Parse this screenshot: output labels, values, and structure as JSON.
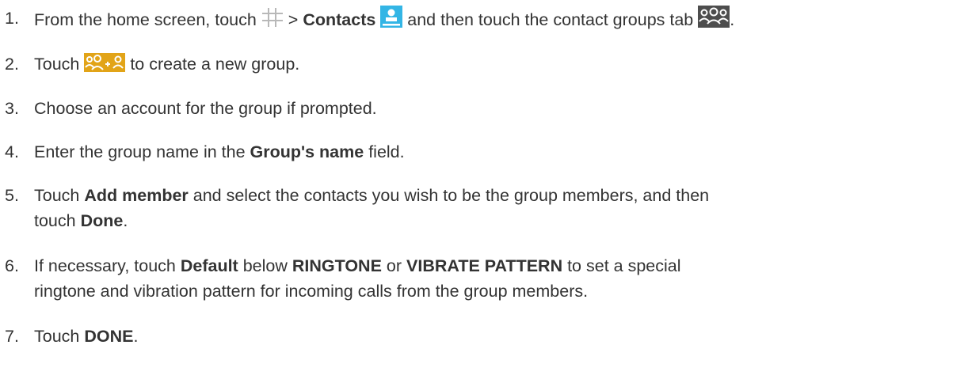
{
  "steps": [
    {
      "number": "1.",
      "parts": {
        "a": "From the home screen, touch",
        "b": " > ",
        "c": "Contacts",
        "d": " and then touch the contact groups tab",
        "e": "."
      },
      "icons": [
        "apps-grid-icon",
        "contacts-app-icon",
        "contact-groups-tab-icon"
      ],
      "colors": {
        "contacts_icon": "#33b5e5",
        "group_icon_bg": "#4d4d4d"
      }
    },
    {
      "number": "2.",
      "parts": {
        "a": "Touch",
        "b": " to create a new group."
      },
      "icons": [
        "add-group-icon"
      ],
      "colors": {
        "add_group_icon_bg": "#e2a418"
      }
    },
    {
      "number": "3.",
      "parts": {
        "a": "Choose an account for the group if prompted."
      }
    },
    {
      "number": "4.",
      "parts": {
        "a": "Enter the group name in the ",
        "b": "Group's name",
        "c": " field."
      }
    },
    {
      "number": "5.",
      "parts": {
        "a": "Touch ",
        "b": "Add member",
        "c": " and select the contacts you wish to be the group members, and then",
        "d": "touch ",
        "e": "Done",
        "f": "."
      }
    },
    {
      "number": "6.",
      "parts": {
        "a": "If necessary, touch ",
        "b": "Default",
        "c": " below ",
        "d": "RINGTONE",
        "e": " or ",
        "f": "VIBRATE PATTERN",
        "g": " to set a special",
        "h": "ringtone and vibration pattern for incoming calls from the group members."
      }
    },
    {
      "number": "7.",
      "parts": {
        "a": "Touch ",
        "b": "DONE",
        "c": "."
      }
    }
  ]
}
